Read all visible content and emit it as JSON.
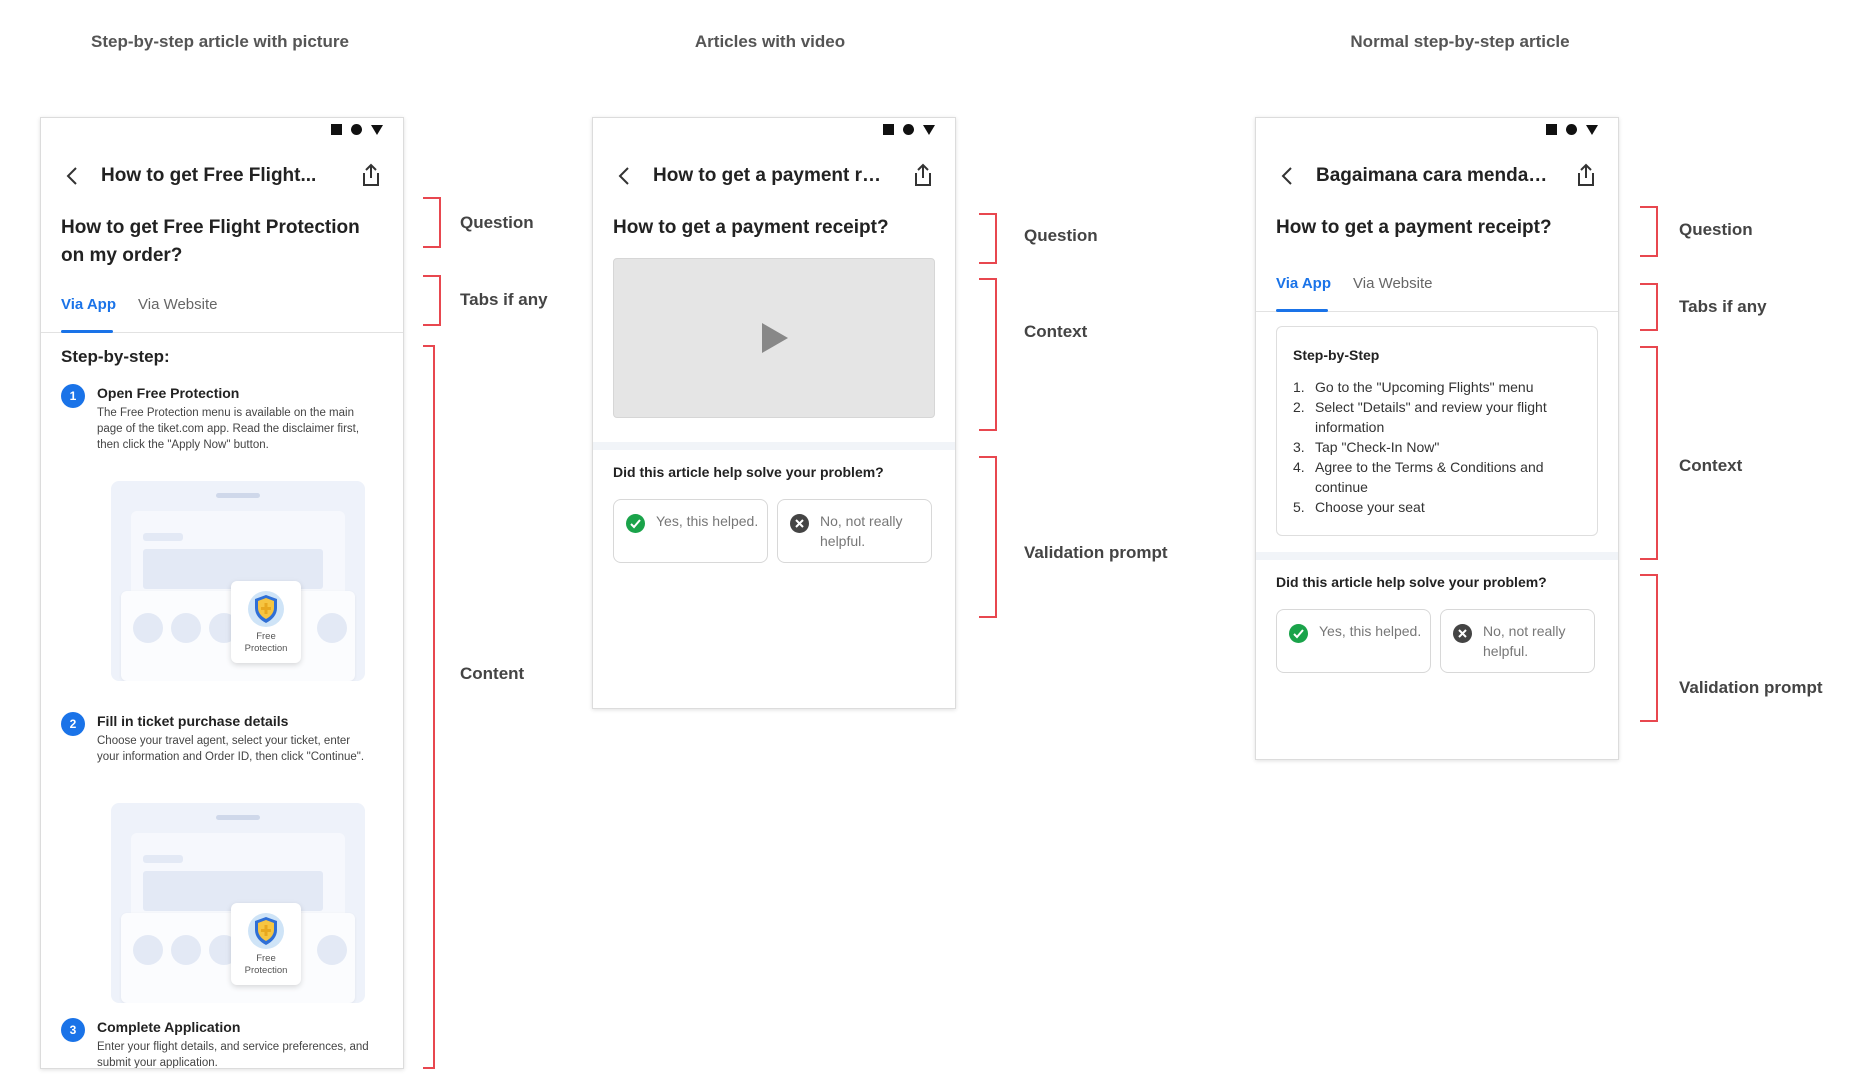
{
  "sections": {
    "picture": "Step-by-step article with picture",
    "video": "Articles with video",
    "normal": "Normal step-by-step article"
  },
  "annotations": {
    "question": "Question",
    "tabs": "Tabs if any",
    "content": "Content",
    "context": "Context",
    "validation": "Validation prompt"
  },
  "phone1": {
    "title": "How to get Free Flight...",
    "question": "How to get Free Flight Protection on my order?",
    "tabs": [
      "Via App",
      "Via Website"
    ],
    "step_heading": "Step-by-step:",
    "steps": [
      {
        "num": "1",
        "title": "Open Free Protection",
        "desc": "The Free Protection menu is available on the main page of the tiket.com app. Read the disclaimer first, then click the \"Apply Now\" button."
      },
      {
        "num": "2",
        "title": "Fill in ticket purchase details",
        "desc": "Choose your travel agent, select your ticket, enter your information and Order ID, then click \"Continue\"."
      },
      {
        "num": "3",
        "title": "Complete Application",
        "desc": "Enter your flight details, and service preferences, and submit your application."
      }
    ],
    "badge_line1": "Free",
    "badge_line2": "Protection"
  },
  "phone2": {
    "title": "How to get a payment rec...",
    "question": "How to get a payment receipt?",
    "prompt": "Did this article help solve your problem?",
    "yes": "Yes, this helped.",
    "no": "No, not really helpful."
  },
  "phone3": {
    "title": "Bagaimana cara mendapat...",
    "question": "How to get a payment receipt?",
    "tabs": [
      "Via App",
      "Via Website"
    ],
    "card_title": "Step-by-Step",
    "items": [
      {
        "n": "1.",
        "text": "Go to the \"Upcoming Flights\" menu"
      },
      {
        "n": "2.",
        "text": "Select \"Details\" and review your flight information"
      },
      {
        "n": "3.",
        "text": "Tap \"Check-In Now\""
      },
      {
        "n": "4.",
        "text": "Agree to the Terms & Conditions and continue"
      },
      {
        "n": "5.",
        "text": "Choose your seat"
      }
    ],
    "prompt": "Did this article help solve your problem?",
    "yes": "Yes, this helped.",
    "no": "No, not really helpful."
  },
  "colors": {
    "accent": "#1a73e8",
    "annotation": "#e8474f",
    "success": "#1aa34a"
  }
}
